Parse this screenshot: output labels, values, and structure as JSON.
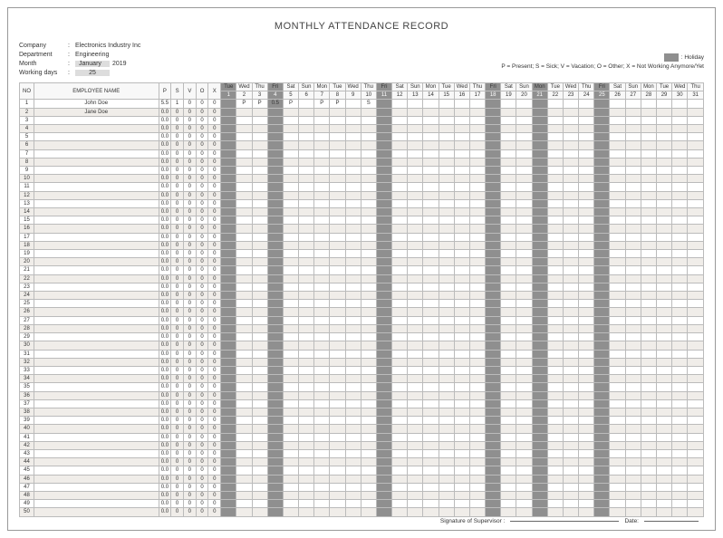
{
  "title": "MONTHLY ATTENDANCE RECORD",
  "meta": {
    "labels": {
      "company": "Company",
      "department": "Department",
      "month": "Month",
      "working_days": "Working days"
    },
    "company": "Electronics Industry Inc",
    "department": "Engineering",
    "month": "January",
    "year": "2019",
    "working_days": "25"
  },
  "legend": {
    "holiday": ": Holiday",
    "codes": "P = Present;  S = Sick;   V = Vacation;  O = Other;  X = Not Working Anymore/Yet"
  },
  "headers": {
    "no": "NO",
    "name": "EMPLOYEE NAME",
    "sums": [
      "P",
      "S",
      "V",
      "O",
      "X"
    ]
  },
  "days": [
    {
      "n": 1,
      "d": "Tue",
      "hol": true
    },
    {
      "n": 2,
      "d": "Wed",
      "hol": false
    },
    {
      "n": 3,
      "d": "Thu",
      "hol": false
    },
    {
      "n": 4,
      "d": "Fri",
      "hol": true
    },
    {
      "n": 5,
      "d": "Sat",
      "hol": false
    },
    {
      "n": 6,
      "d": "Sun",
      "hol": false
    },
    {
      "n": 7,
      "d": "Mon",
      "hol": false
    },
    {
      "n": 8,
      "d": "Tue",
      "hol": false
    },
    {
      "n": 9,
      "d": "Wed",
      "hol": false
    },
    {
      "n": 10,
      "d": "Thu",
      "hol": false
    },
    {
      "n": 11,
      "d": "Fri",
      "hol": true
    },
    {
      "n": 12,
      "d": "Sat",
      "hol": false
    },
    {
      "n": 13,
      "d": "Sun",
      "hol": false
    },
    {
      "n": 14,
      "d": "Mon",
      "hol": false
    },
    {
      "n": 15,
      "d": "Tue",
      "hol": false
    },
    {
      "n": 16,
      "d": "Wed",
      "hol": false
    },
    {
      "n": 17,
      "d": "Thu",
      "hol": false
    },
    {
      "n": 18,
      "d": "Fri",
      "hol": true
    },
    {
      "n": 19,
      "d": "Sat",
      "hol": false
    },
    {
      "n": 20,
      "d": "Sun",
      "hol": false
    },
    {
      "n": 21,
      "d": "Mon",
      "hol": true
    },
    {
      "n": 22,
      "d": "Tue",
      "hol": false
    },
    {
      "n": 23,
      "d": "Wed",
      "hol": false
    },
    {
      "n": 24,
      "d": "Thu",
      "hol": false
    },
    {
      "n": 25,
      "d": "Fri",
      "hol": true
    },
    {
      "n": 26,
      "d": "Sat",
      "hol": false
    },
    {
      "n": 27,
      "d": "Sun",
      "hol": false
    },
    {
      "n": 28,
      "d": "Mon",
      "hol": false
    },
    {
      "n": 29,
      "d": "Tue",
      "hol": false
    },
    {
      "n": 30,
      "d": "Wed",
      "hol": false
    },
    {
      "n": 31,
      "d": "Thu",
      "hol": false
    }
  ],
  "rows": [
    {
      "no": 1,
      "name": "John Doe",
      "sums": [
        "5.5",
        "1",
        "0",
        "0",
        "0"
      ],
      "marks": {
        "2": "P",
        "3": "P",
        "4": "0.5",
        "5": "P",
        "7": "P",
        "8": "P",
        "10": "S"
      }
    },
    {
      "no": 2,
      "name": "Jane Doe",
      "sums": [
        "0.0",
        "0",
        "0",
        "0",
        "0"
      ],
      "marks": {}
    }
  ],
  "empty_sums": [
    "0.0",
    "0",
    "0",
    "0",
    "0"
  ],
  "total_rows": 50,
  "footer": {
    "sig_label": "Signature of Supervisor :",
    "date_label": "Date:"
  }
}
